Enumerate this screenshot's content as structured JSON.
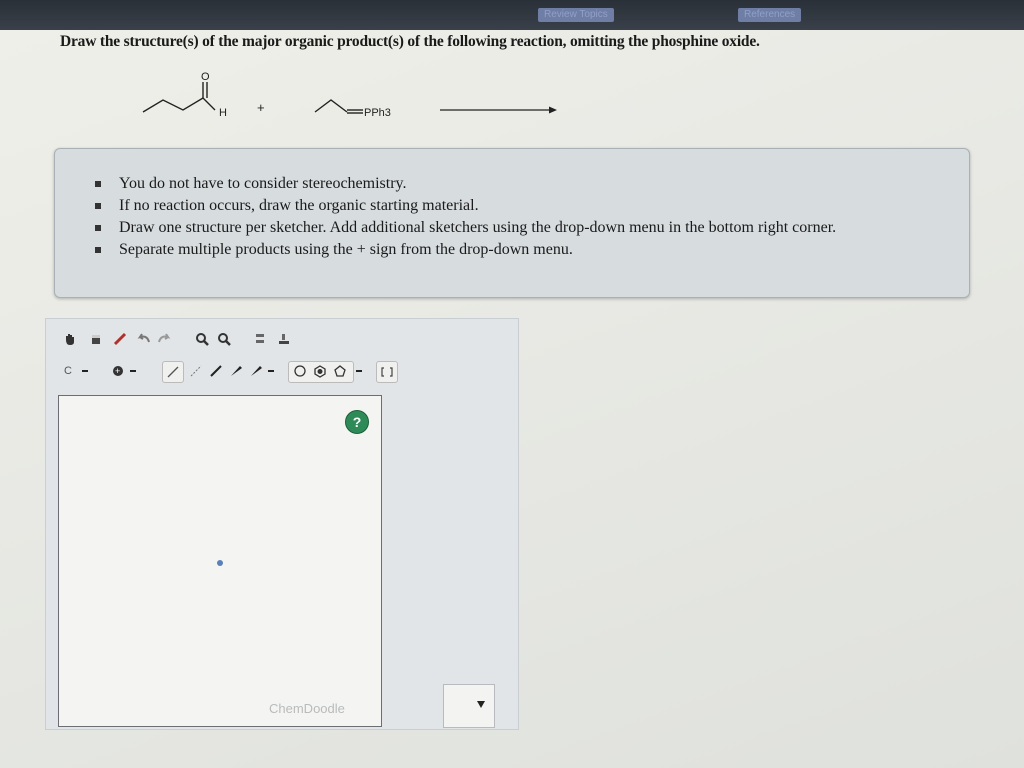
{
  "topbar": {
    "links": [
      "Review Topics",
      "References"
    ]
  },
  "question": {
    "prompt": "Draw the structure(s) of the major organic product(s) of the following reaction, omitting the phosphine oxide."
  },
  "reaction": {
    "aldehyde_oxygen": "O",
    "aldehyde_h": "H",
    "plus": "+",
    "ylide_label": "PPh3"
  },
  "instructions": [
    "You do not have to consider stereochemistry.",
    "If no reaction occurs, draw the organic starting material.",
    "Draw one structure per sketcher. Add additional sketchers using the drop-down menu in the bottom right corner.",
    "Separate multiple products using the + sign from the drop-down menu."
  ],
  "sketcher": {
    "element_button": "C",
    "help": "?",
    "watermark": "ChemDoodle",
    "row1_icons": [
      "hand-icon",
      "eraser-icon",
      "pencil-icon",
      "undo-icon",
      "redo-icon",
      "zoom-in-icon",
      "zoom-out-icon",
      "center-icon",
      "clear-icon"
    ],
    "row2_icons": [
      "element-c-button",
      "charge-button",
      "single-bond-icon",
      "wedge-bond-icon",
      "double-bond-icon",
      "triple-bond-icon",
      "ring-icon",
      "bracket-icon"
    ]
  },
  "add_sketcher_dropdown": {
    "value": ""
  }
}
